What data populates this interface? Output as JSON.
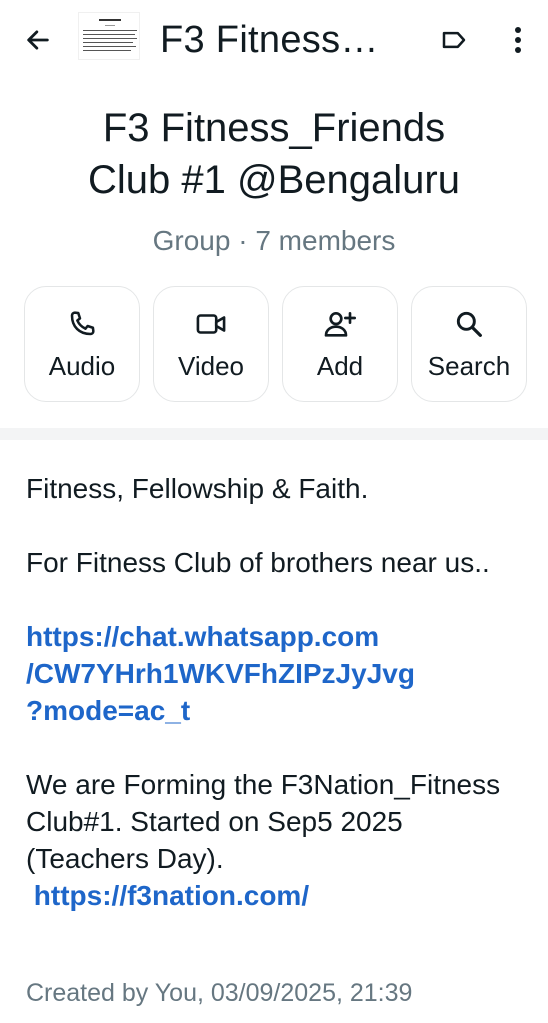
{
  "header": {
    "title": "F3 Fitness…",
    "icons": {
      "back": "arrow-left-icon",
      "label": "label-tag-icon",
      "more": "more-vertical-icon"
    }
  },
  "group": {
    "name_line1": "F3 Fitness_Friends",
    "name_line2": "Club #1 @Bengaluru",
    "subtitle": "Group · 7 members"
  },
  "actions": [
    {
      "label": "Audio",
      "icon": "phone-icon"
    },
    {
      "label": "Video",
      "icon": "video-icon"
    },
    {
      "label": "Add",
      "icon": "add-person-icon"
    },
    {
      "label": "Search",
      "icon": "search-icon"
    }
  ],
  "description": {
    "line1": "Fitness, Fellowship & Faith.",
    "line2": "For Fitness Club of brothers near us..",
    "link1_a": "https://chat.whatsapp.com",
    "link1_b": "/CW7YHrh1WKVFhZIPzJyJvg",
    "link1_c": "?mode=ac_t",
    "line3": "We are Forming the F3Nation_Fitness Club#1. Started on Sep5 2025 (Teachers Day).",
    "link2": "https://f3nation.com/"
  },
  "created": "Created by You, 03/09/2025, 21:39",
  "colors": {
    "link": "#1e66c9",
    "muted": "#667781",
    "text": "#111b21"
  }
}
